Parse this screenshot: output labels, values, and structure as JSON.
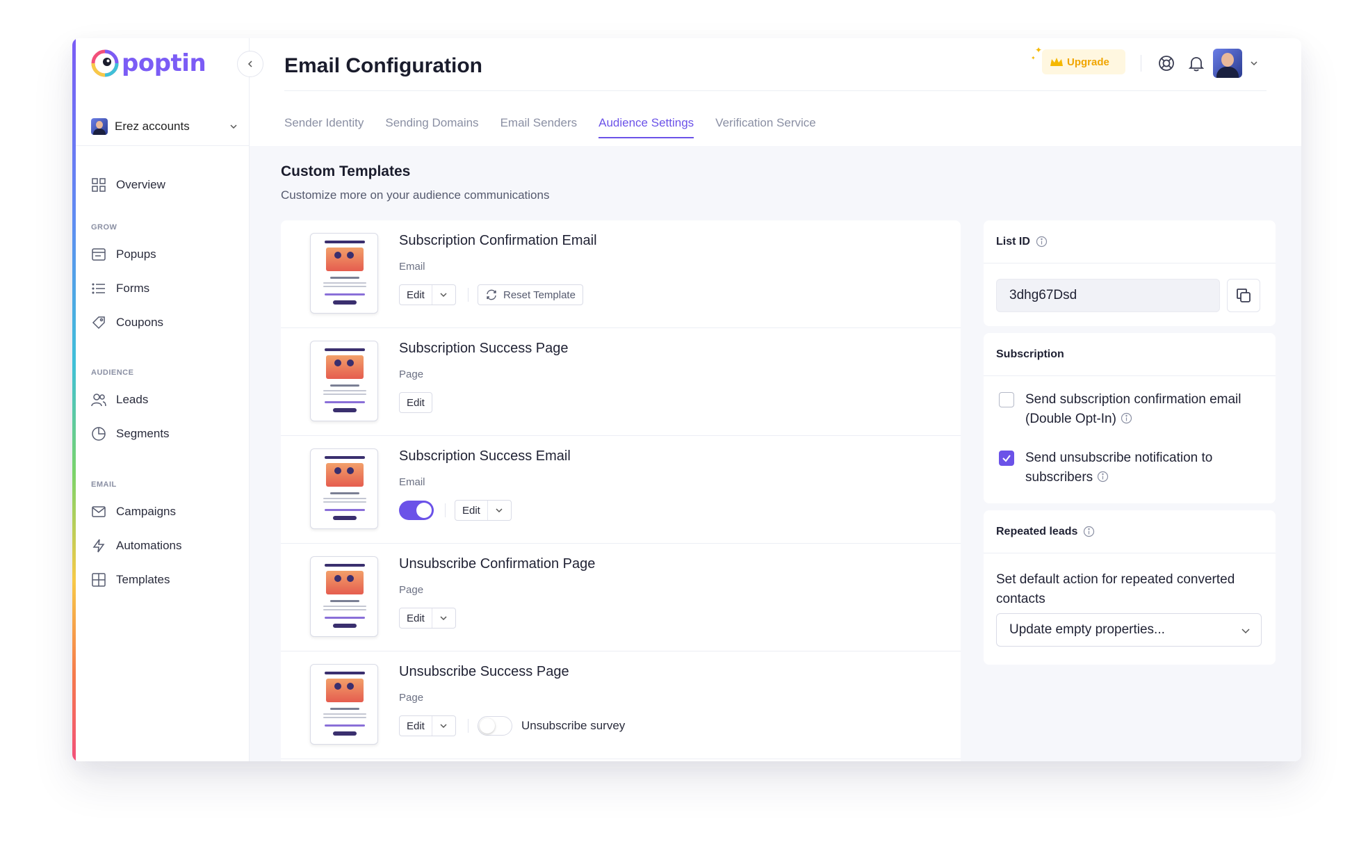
{
  "brand": {
    "name": "poptin",
    "accent": "#6b52e8"
  },
  "account": {
    "name": "Erez accounts"
  },
  "sidebar": {
    "overview": "Overview",
    "sections": [
      {
        "title": "GROW",
        "items": [
          "Popups",
          "Forms",
          "Coupons"
        ]
      },
      {
        "title": "AUDIENCE",
        "items": [
          "Leads",
          "Segments"
        ]
      },
      {
        "title": "EMAIL",
        "items": [
          "Campaigns",
          "Automations",
          "Templates"
        ]
      }
    ]
  },
  "header": {
    "title": "Email Configuration",
    "upgrade_label": "Upgrade",
    "tabs": [
      "Sender Identity",
      "Sending Domains",
      "Email Senders",
      "Audience Settings",
      "Verification Service"
    ],
    "active_tab": "Audience Settings"
  },
  "templates": {
    "title": "Custom Templates",
    "subtitle": "Customize more on your audience communications",
    "rows": [
      {
        "title": "Subscription Confirmation Email",
        "type": "Email",
        "edit": "Edit",
        "reset": "Reset Template"
      },
      {
        "title": "Subscription Success Page",
        "type": "Page",
        "edit": "Edit"
      },
      {
        "title": "Subscription Success Email",
        "type": "Email",
        "edit": "Edit",
        "toggle_on": true
      },
      {
        "title": "Unsubscribe Confirmation Page",
        "type": "Page",
        "edit": "Edit"
      },
      {
        "title": "Unsubscribe Success Page",
        "type": "Page",
        "edit": "Edit",
        "survey_label": "Unsubscribe survey",
        "survey_on": false
      }
    ]
  },
  "list_id": {
    "label": "List ID",
    "value": "3dhg67Dsd"
  },
  "subscription": {
    "label": "Subscription",
    "options": [
      {
        "text": "Send subscription confirmation email (Double Opt-In)",
        "checked": false
      },
      {
        "text": "Send unsubscribe notification to subscribers",
        "checked": true
      }
    ]
  },
  "repeated_leads": {
    "label": "Repeated leads",
    "description": "Set default action for repeated converted contacts",
    "selected": "Update empty properties..."
  }
}
